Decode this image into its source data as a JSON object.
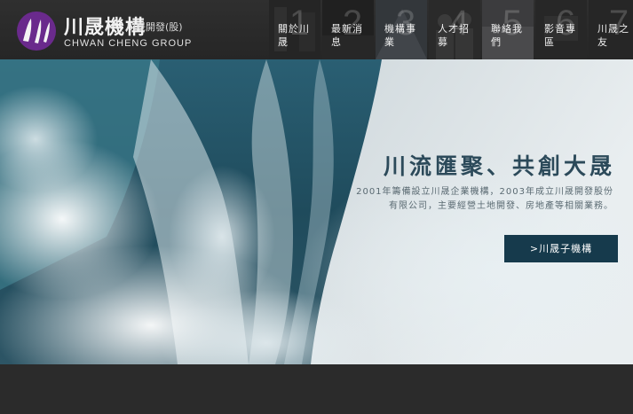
{
  "logo": {
    "main": "川晟機構",
    "sub": "川晟開發(股)",
    "en": "CHWAN CHENG GROUP",
    "accent": "#6a2a8c"
  },
  "nav": {
    "items": [
      {
        "num": "1",
        "label": "關於川晟"
      },
      {
        "num": "2",
        "label": "最新消息"
      },
      {
        "num": "3",
        "label": "機構事業"
      },
      {
        "num": "4",
        "label": "人才招募"
      },
      {
        "num": "5",
        "label": "聯絡我們"
      },
      {
        "num": "6",
        "label": "影音專區"
      },
      {
        "num": "7",
        "label": "川晟之友"
      }
    ]
  },
  "hero": {
    "title": "川流匯聚、共創大晟",
    "desc": "2001年籌備設立川晟企業機構，2003年成立川晟開發股份有限公司，主要經營土地開發、房地產等相關業務。",
    "cta": ">川晟子機構",
    "cta_color": "#163a4c"
  }
}
